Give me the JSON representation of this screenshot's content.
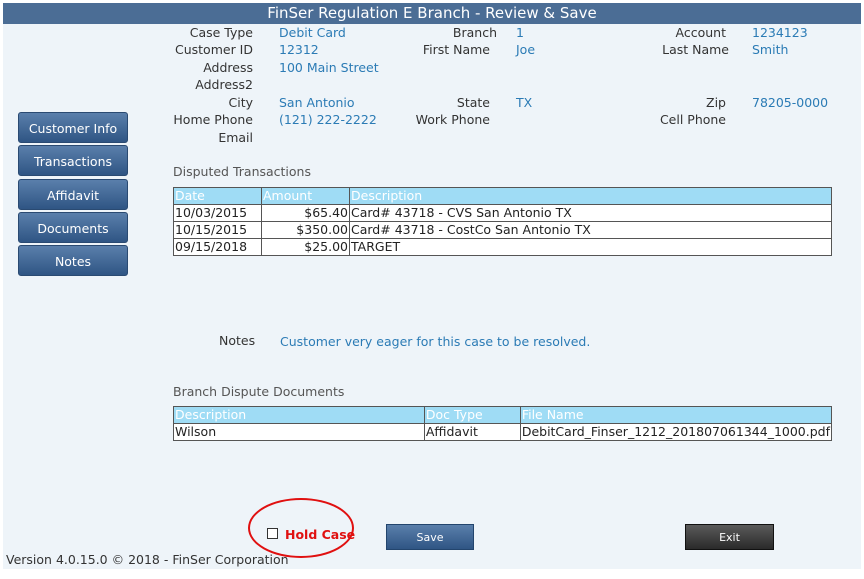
{
  "window": {
    "title": "FinSer Regulation E Branch - Review & Save"
  },
  "nav": [
    {
      "label": "Customer Info"
    },
    {
      "label": "Transactions"
    },
    {
      "label": "Affidavit"
    },
    {
      "label": "Documents"
    },
    {
      "label": "Notes"
    }
  ],
  "customer": {
    "case_type_label": "Case Type",
    "case_type": "Debit Card",
    "branch_label": "Branch",
    "branch": "1",
    "account_label": "Account",
    "account": "1234123",
    "customer_id_label": "Customer ID",
    "customer_id": "12312",
    "first_name_label": "First Name",
    "first_name": "Joe",
    "last_name_label": "Last Name",
    "last_name": "Smith",
    "address_label": "Address",
    "address": "100 Main Street",
    "address2_label": "Address2",
    "address2": "",
    "city_label": "City",
    "city": "San Antonio",
    "state_label": "State",
    "state": "TX",
    "zip_label": "Zip",
    "zip": "78205-0000",
    "home_phone_label": "Home Phone",
    "home_phone": "(121) 222-2222",
    "work_phone_label": "Work Phone",
    "work_phone": "",
    "cell_phone_label": "Cell Phone",
    "cell_phone": "",
    "email_label": "Email",
    "email": ""
  },
  "disputed": {
    "title": "Disputed Transactions",
    "headers": [
      "Date",
      "Amount",
      "Description"
    ],
    "rows": [
      [
        "10/03/2015",
        "$65.40",
        "Card# 43718 - CVS San Antonio TX"
      ],
      [
        "10/15/2015",
        "$350.00",
        "Card# 43718 - CostCo San Antonio TX"
      ],
      [
        "09/15/2018",
        "$25.00",
        "TARGET"
      ]
    ]
  },
  "notes": {
    "label": "Notes",
    "value": "Customer very eager for this case to be resolved."
  },
  "documents": {
    "title": "Branch Dispute Documents",
    "headers": [
      "Description",
      "Doc Type",
      "File Name"
    ],
    "rows": [
      [
        "Wilson",
        "Affidavit",
        "DebitCard_Finser_1212_201807061344_1000.pdf"
      ]
    ]
  },
  "footer": {
    "hold_case_label": "Hold Case",
    "hold_case_checked": false,
    "save_label": "Save",
    "exit_label": "Exit",
    "version": "Version 4.0.15.0 © 2018 - FinSer Corporation"
  },
  "colors": {
    "title_bar": "#4b6d95",
    "value_text": "#2b7bb5",
    "table_header": "#9fdcf5",
    "hold_highlight": "#e01010"
  }
}
